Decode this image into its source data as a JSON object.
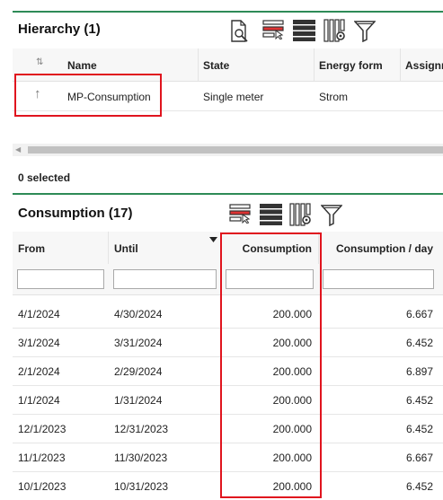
{
  "hierarchy": {
    "title": "Hierarchy (1)",
    "columns": {
      "sort": "⇅",
      "name": "Name",
      "state": "State",
      "energy": "Energy form",
      "assign": "Assignm"
    },
    "row": {
      "arrow": "↑",
      "name": "MP-Consumption",
      "state": "Single meter",
      "energy": "Strom"
    },
    "selected_text": "0 selected"
  },
  "consumption": {
    "title": "Consumption (17)",
    "columns": {
      "from": "From",
      "until": "Until",
      "consumption": "Consumption",
      "per_day": "Consumption / day"
    },
    "rows": [
      {
        "from": "4/1/2024",
        "until": "4/30/2024",
        "consumption": "200.000",
        "per_day": "6.667"
      },
      {
        "from": "3/1/2024",
        "until": "3/31/2024",
        "consumption": "200.000",
        "per_day": "6.452"
      },
      {
        "from": "2/1/2024",
        "until": "2/29/2024",
        "consumption": "200.000",
        "per_day": "6.897"
      },
      {
        "from": "1/1/2024",
        "until": "1/31/2024",
        "consumption": "200.000",
        "per_day": "6.452"
      },
      {
        "from": "12/1/2023",
        "until": "12/31/2023",
        "consumption": "200.000",
        "per_day": "6.452"
      },
      {
        "from": "11/1/2023",
        "until": "11/30/2023",
        "consumption": "200.000",
        "per_day": "6.667"
      },
      {
        "from": "10/1/2023",
        "until": "10/31/2023",
        "consumption": "200.000",
        "per_day": "6.452"
      }
    ]
  },
  "icons": [
    "search-document-icon",
    "row-select-icon",
    "list-view-icon",
    "column-settings-icon",
    "filter-icon"
  ],
  "colors": {
    "accent_green": "#2e8b57",
    "highlight_red": "#e0141e"
  }
}
